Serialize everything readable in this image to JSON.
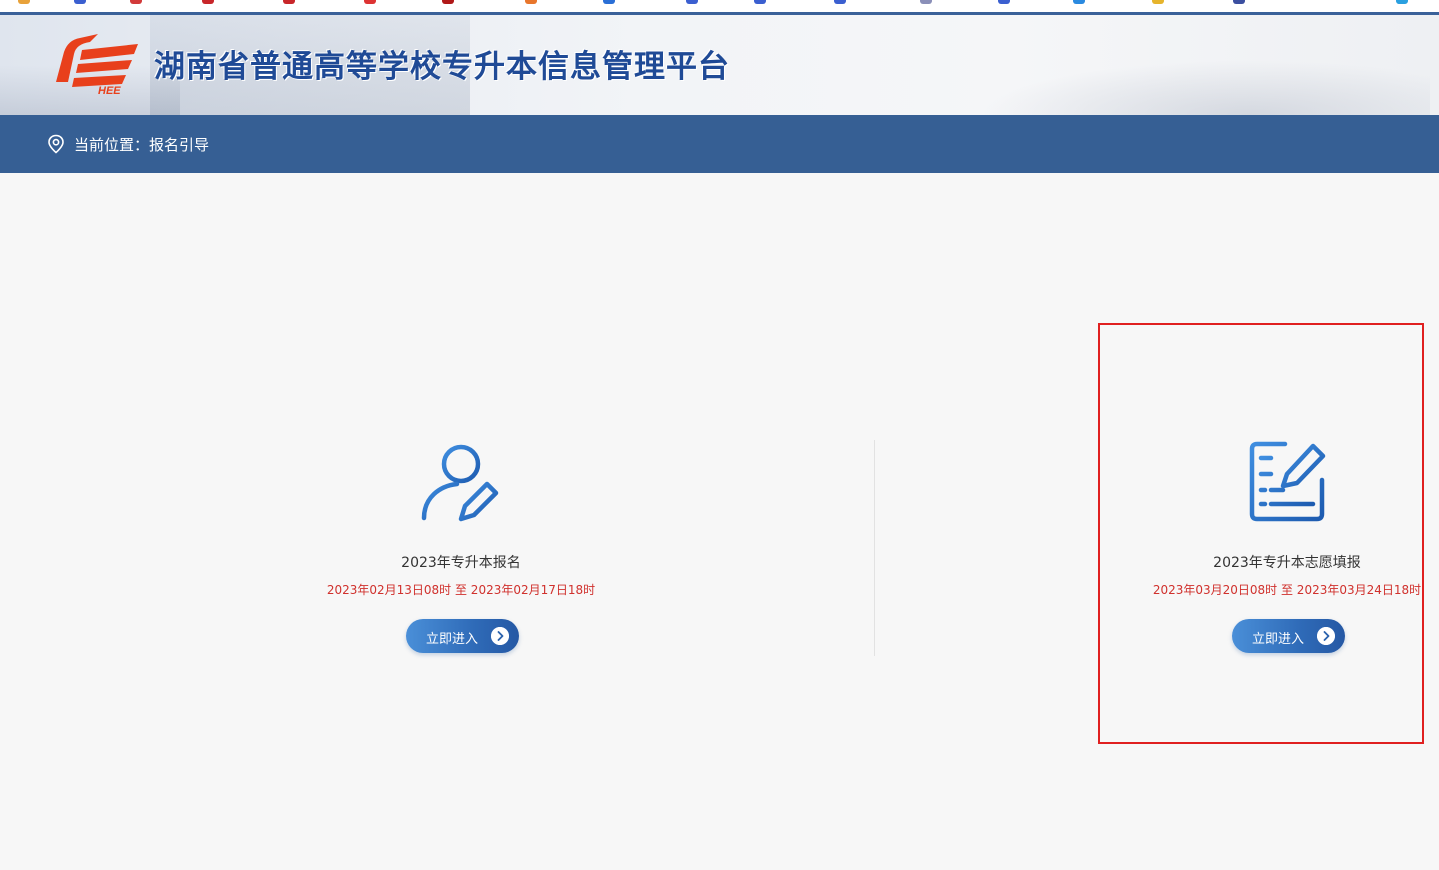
{
  "header": {
    "title": "湖南省普通高等学校专升本信息管理平台",
    "logo_text": "HEE"
  },
  "breadcrumb": {
    "prefix": "当前位置：",
    "current": "报名引导"
  },
  "cards": [
    {
      "title": "2023年专升本报名",
      "date_range": "2023年02月13日08时 至 2023年02月17日18时",
      "button_label": "立即进入",
      "icon": "user-edit-icon"
    },
    {
      "title": "2023年专升本志愿填报",
      "date_range": "2023年03月20日08时 至 2023年03月24日18时",
      "button_label": "立即进入",
      "icon": "form-edit-icon"
    }
  ],
  "colors": {
    "brand_blue": "#1f4a96",
    "nav_bar": "#365f94",
    "date_red": "#d0312d",
    "highlight": "#e02020",
    "logo_orange": "#e8401c"
  }
}
